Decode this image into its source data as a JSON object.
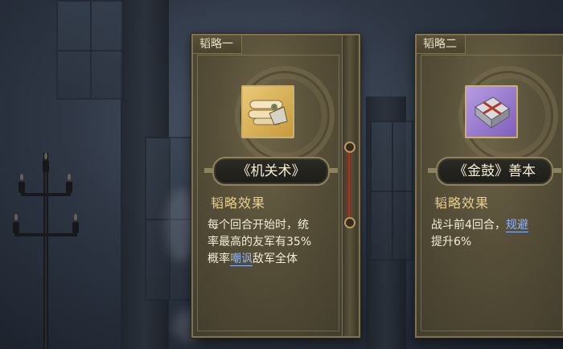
{
  "cards": [
    {
      "header": "韬略一",
      "icon": "scroll-bundle-icon",
      "icon_bg": "#e0bd6a",
      "name": "《机关术》",
      "section_title": "韬略效果",
      "desc_lines": [
        "每个回合开始时，统",
        "率最高的友军有35%"
      ],
      "desc_line3_pre": "概率",
      "keyword": "嘲讽",
      "desc_line3_post": "敌军全体"
    },
    {
      "header": "韬略二",
      "icon": "silver-book-icon",
      "icon_bg": "#a88ad8",
      "name": "《金鼓》善本",
      "section_title": "韬略效果",
      "desc_line1_pre": "战斗前4回合，",
      "keyword": "规避",
      "desc_line2": "提升6%"
    }
  ],
  "colors": {
    "card_gold": "#574f38",
    "keyword_blue": "#8fb4ff",
    "title_gold": "#e6cf8f"
  }
}
